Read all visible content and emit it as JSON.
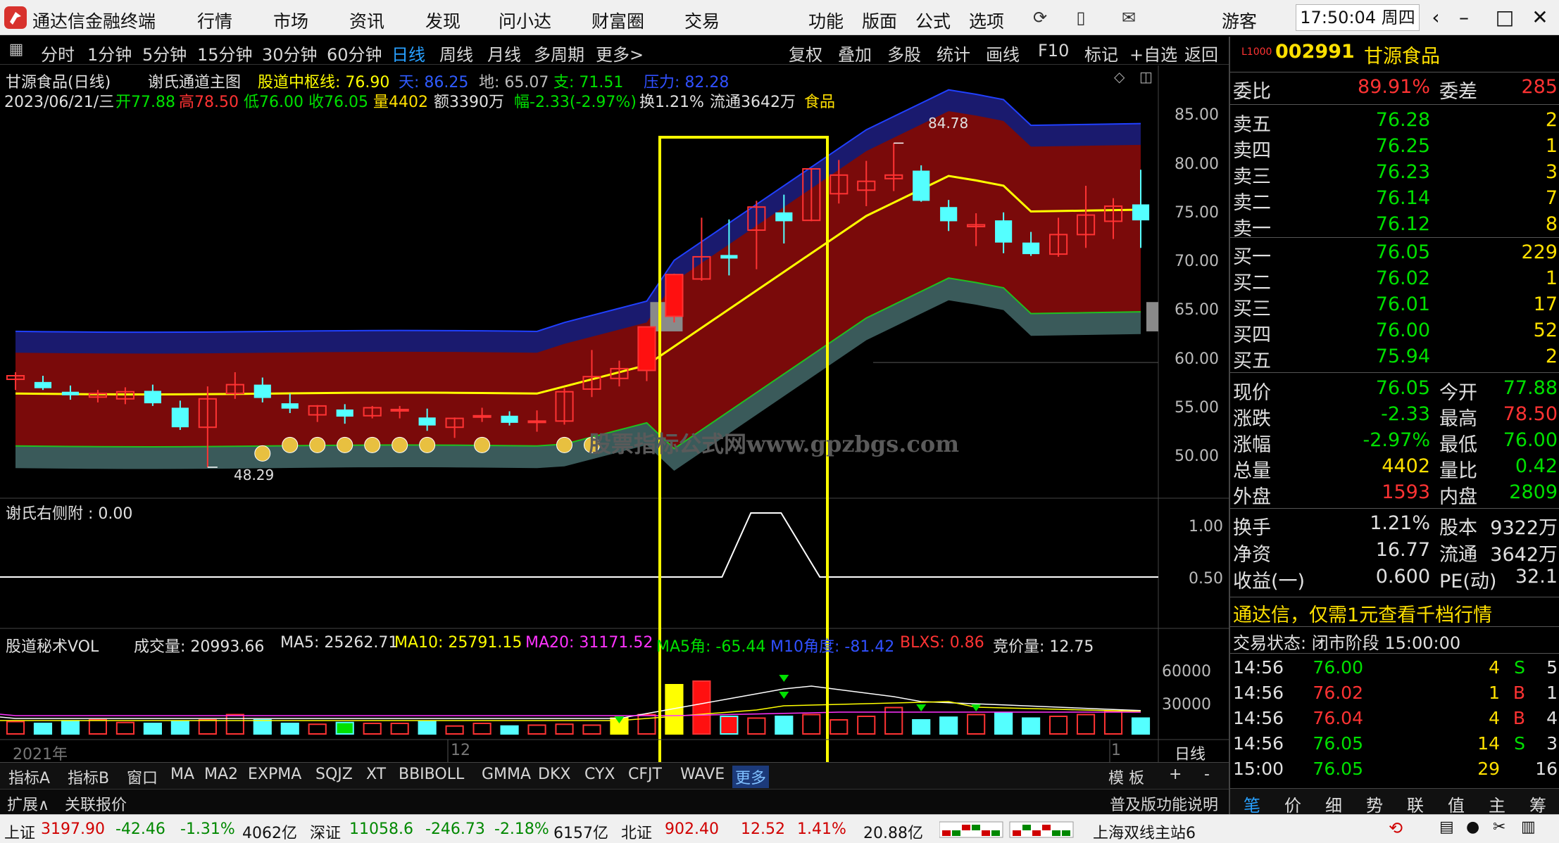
{
  "app": {
    "title": "通达信金融终端",
    "menu": [
      "行情",
      "市场",
      "资讯",
      "发现",
      "问小达",
      "财富圈",
      "交易"
    ],
    "menu2": [
      "功能",
      "版面",
      "公式",
      "选项"
    ],
    "user": "游客",
    "clock": "17:50:04 周四"
  },
  "periods": [
    "分时",
    "1分钟",
    "5分钟",
    "15分钟",
    "30分钟",
    "60分钟",
    "日线",
    "周线",
    "月线",
    "多周期",
    "更多>"
  ],
  "tools": [
    "复权",
    "叠加",
    "多股",
    "统计",
    "画线",
    "F10",
    "标记",
    "+自选",
    "返回"
  ],
  "chart": {
    "title": "甘源食品(日线)",
    "indicator": "谢氏通道主图",
    "center_label": "股道中枢线: 76.90",
    "tian": "天: 86.25",
    "di": "地: 65.07",
    "zhi": "支: 71.51",
    "ya": "压力: 82.28",
    "date_line": "2023/06/21/三",
    "open": "开77.88",
    "high": "高78.50",
    "low": "低76.00",
    "close": "收76.05",
    "volume": "量4402",
    "amount": "额3390万",
    "change": "幅-2.33(-2.97%)",
    "turnover": "换1.21%",
    "float": "流通3642万",
    "sector": "食品",
    "price_axis": [
      "85.00",
      "80.00",
      "75.00",
      "70.00",
      "65.00",
      "60.00",
      "55.00",
      "50.00"
    ],
    "max_label": "84.78",
    "min_label": "48.29",
    "watermark": "股票指标公式网www.gpzbgs.com",
    "sub1_label": "谢氏右侧附 : 0.00",
    "sub1_axis": [
      "1.00",
      "0.50"
    ],
    "vol_line": {
      "name": "股道秘术VOL",
      "vol": "成交量: 20993.66",
      "ma5": "MA5: 25262.71",
      "ma10": "MA10: 25791.15",
      "ma20": "MA20: 31171.52",
      "ma5a": "MA5角: -65.44",
      "m10a": "M10角度: -81.42",
      "blxs": "BLXS: 0.86",
      "jjl": "竞价量: 12.75"
    },
    "vol_axis": [
      "60000",
      "30000"
    ],
    "x_labels": [
      "2021年",
      "12",
      "1"
    ],
    "period_tag": "日线"
  },
  "chart_data": {
    "type": "candlestick",
    "candles": [
      [
        58.2,
        59.0,
        57.0,
        58.6
      ],
      [
        57.9,
        58.6,
        57.0,
        57.2
      ],
      [
        56.8,
        57.5,
        55.9,
        56.4
      ],
      [
        56.2,
        57.0,
        55.6,
        56.6
      ],
      [
        56.0,
        57.3,
        55.4,
        56.8
      ],
      [
        56.9,
        57.6,
        55.2,
        55.5
      ],
      [
        55.0,
        55.8,
        52.5,
        52.8
      ],
      [
        52.8,
        57.4,
        48.3,
        56.0
      ],
      [
        56.6,
        59.0,
        56.0,
        57.6
      ],
      [
        57.6,
        58.4,
        55.6,
        56.1
      ],
      [
        55.5,
        56.6,
        54.4,
        54.9
      ],
      [
        54.2,
        55.3,
        53.4,
        55.2
      ],
      [
        54.8,
        55.4,
        53.2,
        54.0
      ],
      [
        54.1,
        55.2,
        53.8,
        55.0
      ],
      [
        54.7,
        55.2,
        53.8,
        54.8
      ],
      [
        53.9,
        54.9,
        52.4,
        53.0
      ],
      [
        52.8,
        53.9,
        51.6,
        53.8
      ],
      [
        54.0,
        55.0,
        53.4,
        54.1
      ],
      [
        54.1,
        54.6,
        53.0,
        53.3
      ],
      [
        53.4,
        54.7,
        52.3,
        53.5
      ],
      [
        53.5,
        57.2,
        53.1,
        56.8
      ],
      [
        57.1,
        61.5,
        56.2,
        58.5
      ],
      [
        58.3,
        60.3,
        57.4,
        59.4
      ],
      [
        59.2,
        62.1,
        58.0,
        64.1
      ],
      [
        65.3,
        70.1,
        64.6,
        70.0
      ],
      [
        69.5,
        76.4,
        69.3,
        72.0
      ],
      [
        72.2,
        76.2,
        69.9,
        71.8
      ],
      [
        75.0,
        78.3,
        70.6,
        77.6
      ],
      [
        77.0,
        79.0,
        73.5,
        76.0
      ],
      [
        76.1,
        81.9,
        76.0,
        81.9
      ],
      [
        79.1,
        82.9,
        78.0,
        81.2
      ],
      [
        79.5,
        82.8,
        77.7,
        80.5
      ],
      [
        80.8,
        84.8,
        79.4,
        81.2
      ],
      [
        81.7,
        82.3,
        78.2,
        78.3
      ],
      [
        77.6,
        78.4,
        74.9,
        76.0
      ],
      [
        75.4,
        76.9,
        73.2,
        75.6
      ],
      [
        76.1,
        77.0,
        72.4,
        73.6
      ],
      [
        73.6,
        74.8,
        72.1,
        72.3
      ],
      [
        72.3,
        76.4,
        72.0,
        74.5
      ],
      [
        74.5,
        80.0,
        73.0,
        76.7
      ],
      [
        76.0,
        78.6,
        74.0,
        77.7
      ],
      [
        77.9,
        81.8,
        73.0,
        76.1
      ]
    ],
    "tian": 86.25,
    "di": 65.07,
    "zhi": 71.51,
    "ya": 82.28,
    "center": 76.9,
    "ylim": [
      46,
      88
    ]
  },
  "orderbook": {
    "code": "002991",
    "name": "甘源食品",
    "weibi_label": "委比",
    "weibi": "89.91%",
    "weicha_label": "委差",
    "weicha": "285",
    "asks": [
      {
        "label": "卖五",
        "price": "76.28",
        "qty": "2"
      },
      {
        "label": "卖四",
        "price": "76.25",
        "qty": "1"
      },
      {
        "label": "卖三",
        "price": "76.23",
        "qty": "3"
      },
      {
        "label": "卖二",
        "price": "76.14",
        "qty": "7"
      },
      {
        "label": "卖一",
        "price": "76.12",
        "qty": "8"
      }
    ],
    "bids": [
      {
        "label": "买一",
        "price": "76.05",
        "qty": "229"
      },
      {
        "label": "买二",
        "price": "76.02",
        "qty": "1"
      },
      {
        "label": "买三",
        "price": "76.01",
        "qty": "17"
      },
      {
        "label": "买四",
        "price": "76.00",
        "qty": "52"
      },
      {
        "label": "买五",
        "price": "75.94",
        "qty": "2"
      }
    ],
    "stats": [
      {
        "l": "现价",
        "v": "76.05",
        "l2": "今开",
        "v2": "77.88",
        "c": "#00e000",
        "c2": "#00e000"
      },
      {
        "l": "涨跌",
        "v": "-2.33",
        "l2": "最高",
        "v2": "78.50",
        "c": "#00e000",
        "c2": "#ff3333"
      },
      {
        "l": "涨幅",
        "v": "-2.97%",
        "l2": "最低",
        "v2": "76.00",
        "c": "#00e000",
        "c2": "#00e000"
      },
      {
        "l": "总量",
        "v": "4402",
        "l2": "量比",
        "v2": "0.42",
        "c": "#ffe000",
        "c2": "#00e000"
      },
      {
        "l": "外盘",
        "v": "1593",
        "l2": "内盘",
        "v2": "2809",
        "c": "#ff3333",
        "c2": "#00e000"
      }
    ],
    "stats2": [
      {
        "l": "换手",
        "v": "1.21%",
        "l2": "股本",
        "v2": "9322万"
      },
      {
        "l": "净资",
        "v": "16.77",
        "l2": "流通",
        "v2": "3642万"
      },
      {
        "l": "收益(一)",
        "v": "0.600",
        "l2": "PE(动)",
        "v2": "32.1"
      }
    ],
    "promo": "通达信，仅需1元查看千档行情",
    "trade_state": "交易状态: 闭市阶段 15:00:00",
    "ticks": [
      {
        "t": "14:56",
        "p": "76.00",
        "q": "4",
        "s": "S",
        "n": "5"
      },
      {
        "t": "14:56",
        "p": "76.02",
        "q": "1",
        "s": "B",
        "n": "1"
      },
      {
        "t": "14:56",
        "p": "76.04",
        "q": "4",
        "s": "B",
        "n": "4"
      },
      {
        "t": "14:56",
        "p": "76.05",
        "q": "14",
        "s": "S",
        "n": "3"
      },
      {
        "t": "15:00",
        "p": "76.05",
        "q": "29",
        "s": "",
        "n": "16"
      }
    ],
    "bottom_tabs": [
      "笔",
      "价",
      "细",
      "势",
      "联",
      "值",
      "主",
      "筹"
    ]
  },
  "tabs": [
    "指标A",
    "指标B",
    "窗口",
    "MA",
    "MA2",
    "EXPMA",
    "SQJZ",
    "XT",
    "BBIBOLL",
    "GMMA",
    "DKX",
    "CYX",
    "CFJT",
    "WAVE",
    "更多"
  ],
  "tabs_right": [
    "模 板",
    "+",
    "-"
  ],
  "extbar": [
    "扩展∧",
    "关联报价",
    "普及版功能说明"
  ],
  "status": {
    "sh": "上证",
    "sh_v": "3197.90",
    "sh_c": "-42.46",
    "sh_p": "-1.31%",
    "sh_a": "4062亿",
    "sz": "深证",
    "sz_v": "11058.6",
    "sz_c": "-246.73",
    "sz_p": "-2.18%",
    "sz_a": "6157亿",
    "bj": "北证",
    "bj_v": "902.40",
    "bj_c": "12.52",
    "bj_p": "1.41%",
    "bj_a": "20.88亿",
    "server": "上海双线主站6"
  }
}
